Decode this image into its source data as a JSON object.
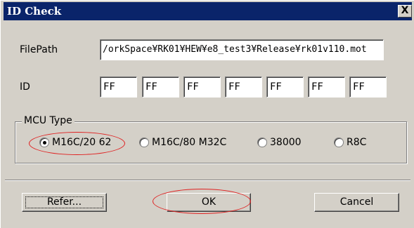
{
  "window": {
    "title": "ID Check",
    "close_symbol": "X"
  },
  "filepath": {
    "label": "FilePath",
    "value": "/orkSpace¥RK01¥HEW¥e8_test3¥Release¥rk01v110.mot"
  },
  "id": {
    "label": "ID",
    "values": [
      "FF",
      "FF",
      "FF",
      "FF",
      "FF",
      "FF",
      "FF"
    ]
  },
  "mcu_type": {
    "label": "MCU Type",
    "options": [
      {
        "label": "M16C/20 62",
        "selected": true
      },
      {
        "label": "M16C/80  M32C",
        "selected": false
      },
      {
        "label": "38000",
        "selected": false
      },
      {
        "label": "R8C",
        "selected": false
      }
    ]
  },
  "buttons": {
    "refer": "Refer...",
    "ok": "OK",
    "cancel": "Cancel"
  },
  "colors": {
    "titlebar": "#0a246a",
    "dialog_bg": "#d4d0c8",
    "highlight_ellipse": "#e02020"
  }
}
